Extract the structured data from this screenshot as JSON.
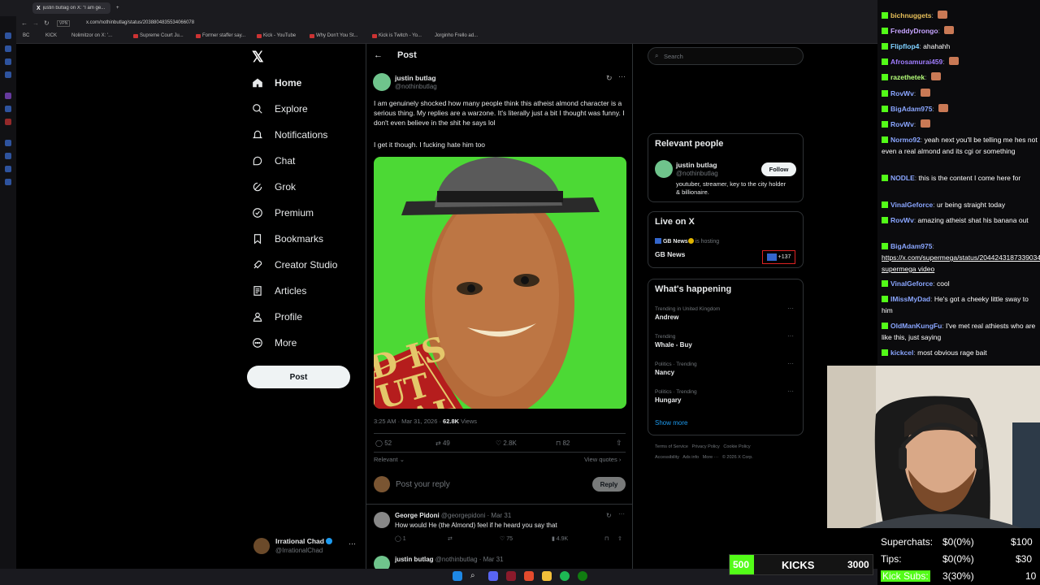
{
  "browser": {
    "tabs": [
      "justin butlag on X: \"I am ge..."
    ],
    "url": "x.com/nothinbutlag/status/2038804835534066078",
    "bookmarks": [
      "BC",
      "KICK",
      "Nolimitzor on X: '...",
      "Supreme Court Ju...",
      "Former staffer say...",
      "Kick - YouTube",
      "Why Don't You St...",
      "Kick is Twitch - Yo...",
      "Jorginho Frello ad..."
    ]
  },
  "sidebar": {
    "items": [
      {
        "label": "Home",
        "icon": "home-icon"
      },
      {
        "label": "Explore",
        "icon": "search-icon"
      },
      {
        "label": "Notifications",
        "icon": "bell-icon"
      },
      {
        "label": "Chat",
        "icon": "chat-icon"
      },
      {
        "label": "Grok",
        "icon": "grok-icon"
      },
      {
        "label": "Premium",
        "icon": "premium-icon"
      },
      {
        "label": "Bookmarks",
        "icon": "bookmark-icon"
      },
      {
        "label": "Creator Studio",
        "icon": "rocket-icon"
      },
      {
        "label": "Articles",
        "icon": "articles-icon"
      },
      {
        "label": "Profile",
        "icon": "person-icon"
      },
      {
        "label": "More",
        "icon": "more-circle-icon"
      }
    ],
    "post_button": "Post",
    "account": {
      "name": "Irrational Chad",
      "handle": "@IrrationalChad"
    }
  },
  "post": {
    "header_title": "Post",
    "author_name": "justin butlag",
    "author_handle": "@nothinbutlag",
    "text1": "I am genuinely shocked how many people think this atheist almond character is a serious thing. My replies are a warzone. It's literally just a bit I thought was funny. I don't even believe in the shit he says lol",
    "text2": "I get it though. I fucking hate him too",
    "image_sign_text": "D IS\nUT\nEAL",
    "timestamp": "3:25 AM · Mar 31, 2026 · ",
    "views_count": "62.8K",
    "views_label": " Views",
    "replies": "52",
    "reposts": "49",
    "likes": "2.8K",
    "bookmarks": "82",
    "sort_label": "Relevant",
    "view_quotes": "View quotes",
    "reply_placeholder": "Post your reply",
    "reply_button": "Reply"
  },
  "replies": [
    {
      "name": "George Pidoni",
      "handle": "@georgepidoni · Mar 31",
      "text": "How would He (the Almond) feel if he heard you say that",
      "replies": "1",
      "likes": "75",
      "views": "4.9K"
    },
    {
      "name": "justin butlag",
      "handle": "@nothinbutlag · Mar 31",
      "text": ""
    }
  ],
  "right": {
    "search_placeholder": "Search",
    "relevant_title": "Relevant people",
    "rel_name": "justin butlag",
    "rel_handle": "@nothinbutlag",
    "rel_bio": "youtuber, streamer, key to the city holder & billionaire.",
    "follow": "Follow",
    "live_title": "Live on X",
    "live_host": "GB News",
    "live_hosting": " is hosting",
    "live_name": "GB News",
    "live_count": "+137",
    "happening_title": "What's happening",
    "trends": [
      {
        "context": "Trending in United Kingdom",
        "name": "Andrew"
      },
      {
        "context": "Trending",
        "name": "Whale - Buy"
      },
      {
        "context": "Politics · Trending",
        "name": "Nancy"
      },
      {
        "context": "Politics · Trending",
        "name": "Hungary"
      }
    ],
    "show_more": "Show more",
    "footer1": "Terms of Service   Privacy Policy   Cookie Policy",
    "footer2": "Accessibility   Ads info   More ···   © 2026 X Corp."
  },
  "chat": {
    "messages": [
      {
        "user": "bichnuggets",
        "color": "#e8c05a",
        "text": "",
        "emote": true
      },
      {
        "user": "FreddyDrongo",
        "color": "#c6a4ff",
        "text": "",
        "emote": true
      },
      {
        "user": "Flipflop4",
        "color": "#7fd0ff",
        "text": "ahahahh"
      },
      {
        "user": "Afrosamurai459",
        "color": "#a07dff",
        "text": "",
        "emote": true
      },
      {
        "user": "razethetek",
        "color": "#b6ff7a",
        "text": "",
        "emote": true
      },
      {
        "user": "RovWv",
        "color": "#8aa6ff",
        "text": "",
        "emote": true
      },
      {
        "user": "BigAdam975",
        "color": "#8aa6ff",
        "text": "",
        "emote": true
      },
      {
        "user": "RovWv",
        "color": "#8aa6ff",
        "text": "",
        "emote": true
      },
      {
        "user": "Normo92",
        "color": "#8aa6ff",
        "text": "yeah next you'll be telling me hes not even a real almond and its cgi or something"
      },
      {
        "user": "NODLE",
        "color": "#8aa6ff",
        "text": "this is the content I come here for"
      },
      {
        "user": "VinalGeforce",
        "color": "#8aa6ff",
        "text": "ur being straight today"
      },
      {
        "user": "RovWv",
        "color": "#8aa6ff",
        "text": "amazing atheist shat his banana out"
      },
      {
        "user": "BigAdam975",
        "color": "#8aa6ff",
        "text": "https://x.com/supermega/status/2044243187339034993 supermega video"
      },
      {
        "user": "VinalGeforce",
        "color": "#8aa6ff",
        "text": "cool"
      },
      {
        "user": "IMissMyDad",
        "color": "#8aa6ff",
        "text": "He's got a cheeky little sway to him"
      },
      {
        "user": "OldManKungFu",
        "color": "#8aa6ff",
        "text": "I've met real athiests who are like this, just saying"
      },
      {
        "user": "kickcel",
        "color": "#8aa6ff",
        "text": "most obvious rage bait"
      }
    ]
  },
  "overlay": {
    "superchats_label": "Superchats:",
    "superchats_value": "$0(0%)",
    "superchats_goal": "$100",
    "tips_label": "Tips:",
    "tips_value": "$0(0%)",
    "tips_goal": "$30",
    "subs_label": "Kick Subs:",
    "subs_value": "3(30%)",
    "subs_goal": "10",
    "kicks_left": "500",
    "kicks_label": "KICKS",
    "kicks_right": "3000"
  }
}
